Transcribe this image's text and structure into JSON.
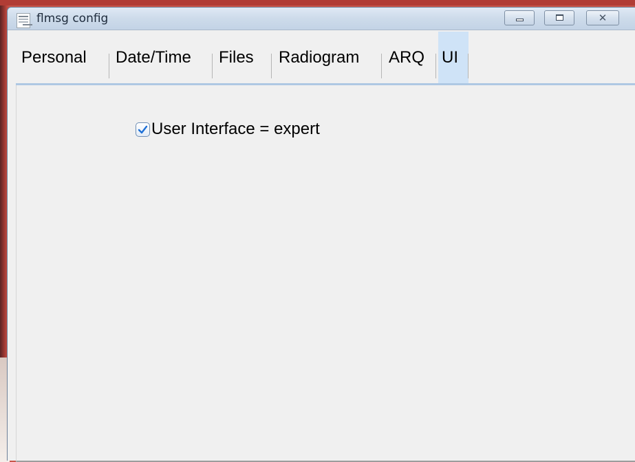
{
  "window": {
    "title": "flmsg config",
    "controls": {
      "minimize_icon": "minimize-icon",
      "maximize_icon": "maximize-icon",
      "close_icon": "close-icon",
      "close_glyph": "✕"
    }
  },
  "tabs": [
    {
      "label": "Personal",
      "active": false
    },
    {
      "label": "Date/Time",
      "active": false
    },
    {
      "label": "Files",
      "active": false
    },
    {
      "label": "Radiogram",
      "active": false
    },
    {
      "label": "ARQ",
      "active": false
    },
    {
      "label": "UI",
      "active": true
    }
  ],
  "ui_panel": {
    "expert_checkbox": {
      "label": "User Interface = expert",
      "checked": true
    }
  },
  "colors": {
    "active_tab": "#cfe3f7",
    "tab_rule": "#aec8e3",
    "checkmark": "#1d6fd6"
  }
}
